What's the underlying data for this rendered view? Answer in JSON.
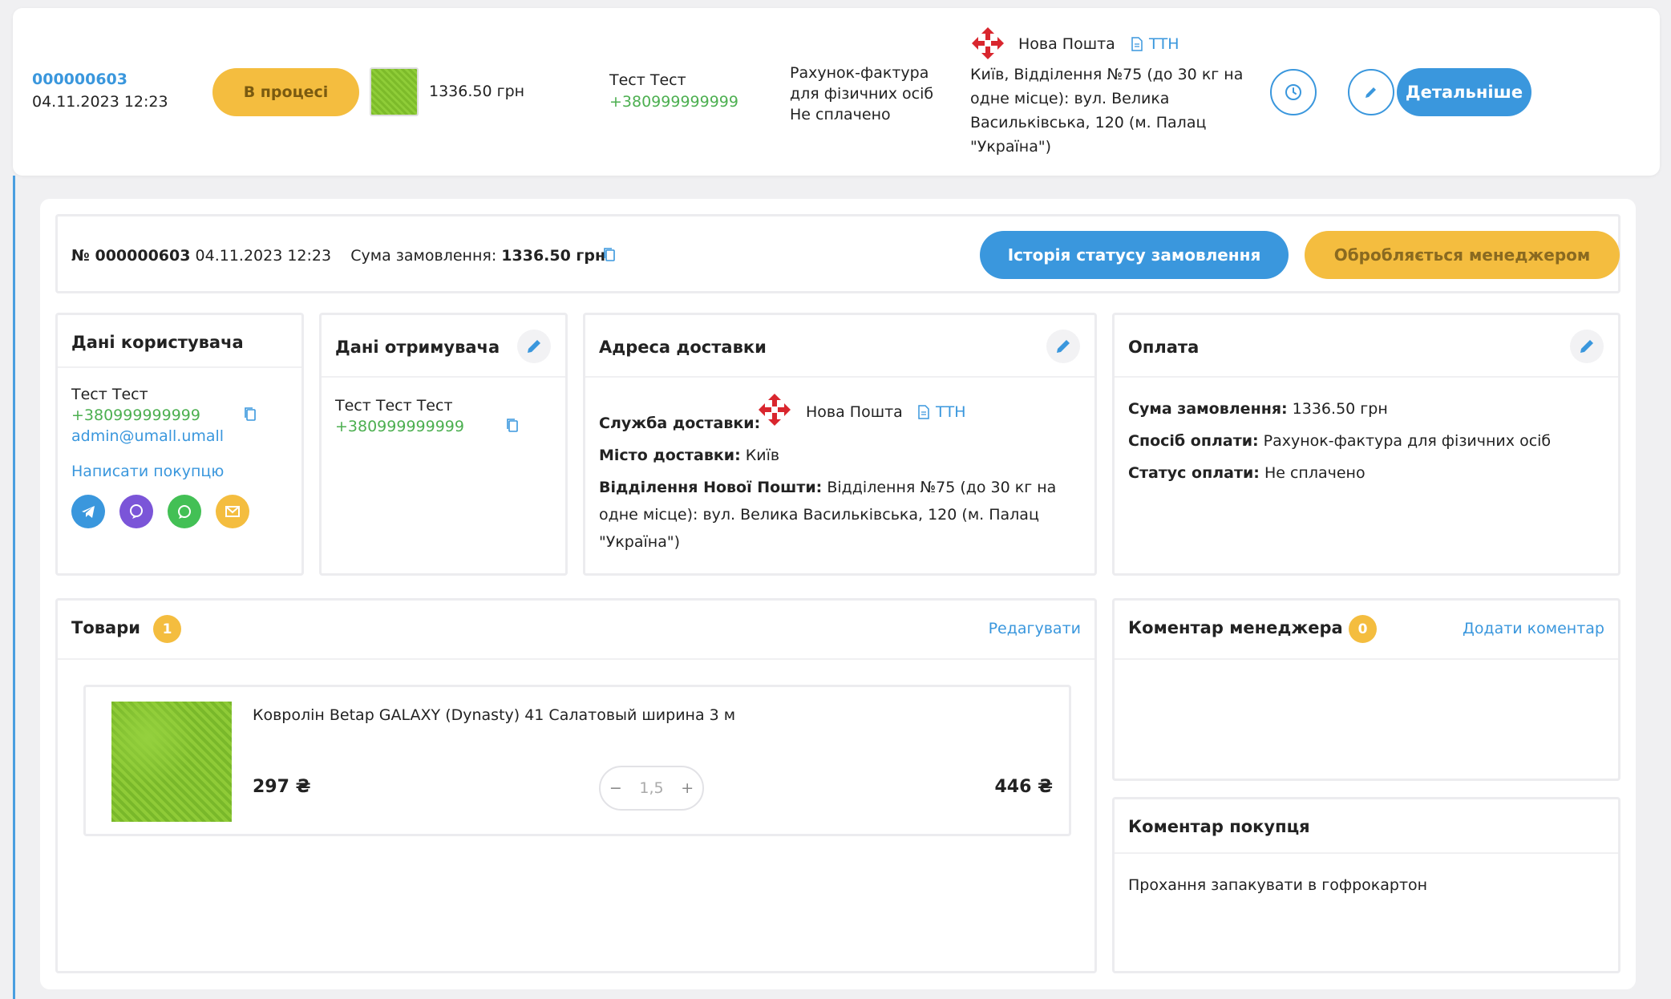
{
  "order_row": {
    "number": "000000603",
    "date": "04.11.2023 12:23",
    "status": "В процесі",
    "total": "1336.50 грн",
    "client_name": "Тест Тест",
    "client_phone": "+380999999999",
    "payment_line1": "Рахунок-фактура",
    "payment_line2": "для фізичних осіб",
    "payment_status": "Не сплачено",
    "carrier": "Нова Пошта",
    "ttn": "ТТН",
    "address": "Київ, Відділення №75 (до 30 кг на одне місце): вул. Велика Васильківська, 120 (м. Палац \"Україна\")",
    "details_button": "Детальніше"
  },
  "summary": {
    "number_prefix": "№ 000000603",
    "date": "04.11.2023 12:23",
    "sum_label": "Сума замовлення:",
    "sum_value": "1336.50 грн",
    "history_button": "Історія статусу замовлення",
    "manager_button": "Обробляється менеджером"
  },
  "user_card": {
    "title": "Дані користувача",
    "name": "Тест Тест",
    "phone": "+380999999999",
    "email": "admin@umall.umall",
    "write_link": "Написати покупцю"
  },
  "recipient_card": {
    "title": "Дані отримувача",
    "name": "Тест Тест Тест",
    "phone": "+380999999999"
  },
  "delivery_card": {
    "title": "Адреса доставки",
    "service_label": "Служба доставки:",
    "carrier": "Нова Пошта",
    "ttn": "ТТН",
    "city_label": "Місто доставки:",
    "city": "Київ",
    "branch_label": "Відділення Нової Пошти:",
    "branch": "Відділення №75 (до 30 кг на одне місце): вул. Велика Васильківська, 120 (м. Палац \"Україна\")"
  },
  "payment_card": {
    "title": "Оплата",
    "sum_label": "Сума замовлення:",
    "sum": "1336.50 грн",
    "method_label": "Спосіб оплати:",
    "method": "Рахунок-фактура для фізичних осіб",
    "status_label": "Статус оплати:",
    "status": "Не сплачено"
  },
  "products": {
    "title": "Товари",
    "count": "1",
    "edit_link": "Редагувати",
    "items": [
      {
        "name": "Ковролін Betap GALAXY (Dynasty) 41 Салатовый ширина 3 м",
        "price": "297 ₴",
        "qty": "1,5",
        "total": "446 ₴"
      }
    ]
  },
  "manager_comment": {
    "title": "Коментар менеджера",
    "count": "0",
    "add_link": "Додати коментар"
  },
  "buyer_comment": {
    "title": "Коментар покупця",
    "text": "Прохання запакувати в гофрокартон"
  },
  "colors": {
    "accent": "#3a97dd",
    "warning": "#f4bd3f",
    "phone": "#4caf50"
  }
}
